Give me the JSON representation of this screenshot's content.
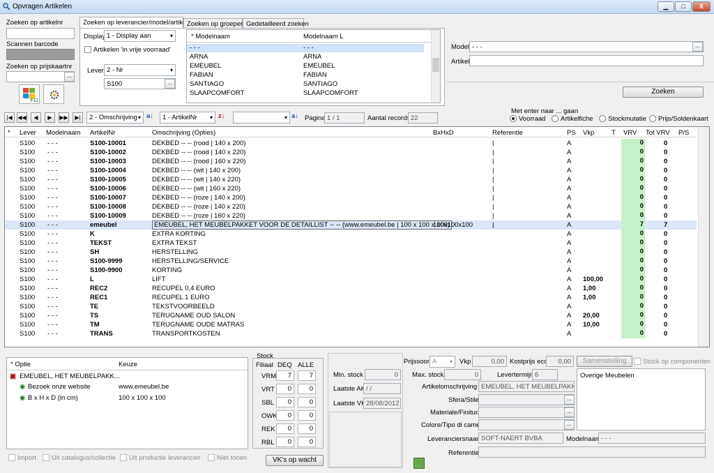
{
  "window": {
    "title": "Opvragen Artikelen",
    "min": "▁",
    "max": "□",
    "close": "X"
  },
  "left": {
    "artikelnr_label": "Zoeken op artikelnr",
    "barcode_label": "Scannen barcode",
    "prijskaart_label": "Zoeken op prijskaartnr",
    "f11": "F11"
  },
  "tabs": {
    "t1": "Zoeken op leverancier/model/artikel",
    "t2": "Zoeken op groepen",
    "t3": "Gedetailleerd zoeken"
  },
  "lev": {
    "display_label": "Display",
    "display_value": "1 - Display aan",
    "vrije_voorraad": "Artikelen 'in vrije voorraad'",
    "lever_label": "Lever",
    "lever_value": "2 - Nr",
    "lever_code": "S100"
  },
  "modellist": {
    "h1": "* Modelnaam",
    "h2": "Modelnaam L",
    "rows": [
      [
        "- - -",
        "- - -"
      ],
      [
        "ARNA",
        "ARNA"
      ],
      [
        "EMEUBEL",
        "EMEUBEL"
      ],
      [
        "FABIAN",
        "FABIAN"
      ],
      [
        "SANTIAGO",
        "SANTIAGO"
      ],
      [
        "SLAAPCOMFORT",
        "SLAAPCOMFORT"
      ]
    ]
  },
  "right": {
    "model_label": "Model",
    "model_value": "- - -",
    "artikel_label": "Artikel",
    "zoeken": "Zoeken"
  },
  "nav": {
    "sort1": "2 - Omschrijving",
    "sort2": "1 - ArtikelNr",
    "sort3": "",
    "pagina_label": "Pagina",
    "pagina": "1 / 1",
    "records_label": "Aantal records",
    "records": "22",
    "enter_label": "Met enter naar ... gaan",
    "r1": "Voorraad",
    "r2": "Artikelfiche",
    "r3": "Stockmutatie",
    "r4": "Prijs/Soldenkaart"
  },
  "grid": {
    "headers": [
      "*",
      "Lever",
      "Modelnaam",
      "ArtikelNr",
      "Omschrijving (Opties)",
      "BxHxD",
      "Referentie",
      "PS",
      "Vkp",
      "T",
      "VRV",
      "Tot VRV",
      "P/S"
    ],
    "rows": [
      [
        "S100",
        "- - -",
        "S100-10001",
        "DEKBED -- -- (rood | 140 x 200)",
        "",
        "|",
        "A",
        "",
        "0",
        "0"
      ],
      [
        "S100",
        "- - -",
        "S100-10002",
        "DEKBED -- -- (rood | 140 x 220)",
        "",
        "|",
        "A",
        "",
        "0",
        "0"
      ],
      [
        "S100",
        "- - -",
        "S100-10003",
        "DEKBED -- -- (rood | 160 x 220)",
        "",
        "|",
        "A",
        "",
        "0",
        "0"
      ],
      [
        "S100",
        "- - -",
        "S100-10004",
        "DEKBED -- -- (wit | 140 x 200)",
        "",
        "|",
        "A",
        "",
        "0",
        "0"
      ],
      [
        "S100",
        "- - -",
        "S100-10005",
        "DEKBED -- -- (wit | 140 x 220)",
        "",
        "|",
        "A",
        "",
        "0",
        "0"
      ],
      [
        "S100",
        "- - -",
        "S100-10006",
        "DEKBED -- -- (wit | 160 x 220)",
        "",
        "|",
        "A",
        "",
        "0",
        "0"
      ],
      [
        "S100",
        "- - -",
        "S100-10007",
        "DEKBED -- -- (roze | 140 x 200)",
        "",
        "|",
        "A",
        "",
        "0",
        "0"
      ],
      [
        "S100",
        "- - -",
        "S100-10008",
        "DEKBED -- -- (roze | 140 x 220)",
        "",
        "|",
        "A",
        "",
        "0",
        "0"
      ],
      [
        "S100",
        "- - -",
        "S100-10009",
        "DEKBED -- -- (roze | 160 x 220)",
        "",
        "|",
        "A",
        "",
        "0",
        "0"
      ],
      [
        "S100",
        "- - -",
        "emeubel",
        "EMEUBEL, HET MEUBELPAKKET VOOR DE DETAILLIST -- -- (www.emeubel.be | 100 x 100 x 100)",
        "100x100x100",
        "|",
        "A",
        "",
        "7",
        "7"
      ],
      [
        "S100",
        "- - -",
        "K",
        "EXTRA KORTING",
        "",
        "",
        "A",
        "",
        "0",
        "0"
      ],
      [
        "S100",
        "- - -",
        "TEKST",
        "EXTRA TEKST",
        "",
        "",
        "A",
        "",
        "0",
        "0"
      ],
      [
        "S100",
        "- - -",
        "SH",
        "HERSTELLING",
        "",
        "",
        "A",
        "",
        "0",
        "0"
      ],
      [
        "S100",
        "- - -",
        "S100-9999",
        "HERSTELLING/SERVICE",
        "",
        "",
        "A",
        "",
        "0",
        "0"
      ],
      [
        "S100",
        "- - -",
        "S100-9900",
        "KORTING",
        "",
        "",
        "A",
        "",
        "0",
        "0"
      ],
      [
        "S100",
        "- - -",
        "L",
        "LIFT",
        "",
        "",
        "A",
        "100,00",
        "0",
        "0"
      ],
      [
        "S100",
        "- - -",
        "REC2",
        "RECUPEL 0,4 EURO",
        "",
        "",
        "A",
        "1,00",
        "0",
        "0"
      ],
      [
        "S100",
        "- - -",
        "REC1",
        "RECUPEL 1 EURO",
        "",
        "",
        "A",
        "1,00",
        "0",
        "0"
      ],
      [
        "S100",
        "- - -",
        "TE",
        "TEKSTVOORBEELD",
        "",
        "",
        "A",
        "",
        "0",
        "0"
      ],
      [
        "S100",
        "- - -",
        "TS",
        "TERUGNAME OUD SALON",
        "",
        "",
        "A",
        "20,00",
        "0",
        "0"
      ],
      [
        "S100",
        "- - -",
        "TM",
        "TERUGNAME OUDE MATRAS",
        "",
        "",
        "A",
        "10,00",
        "0",
        "0"
      ],
      [
        "S100",
        "- - -",
        "TRANS",
        "TRANSPORTKOSTEN",
        "",
        "",
        "A",
        "",
        "0",
        "0"
      ]
    ]
  },
  "opties": {
    "h1": "* Optie",
    "h2": "Keuze",
    "r0": "EMEUBEL, HET MEUBELPAKK...",
    "r1a": "Bezoek onze website",
    "r1b": "www.emeubel.be",
    "r2a": "B x H x D (in cm)",
    "r2b": "100 x 100 x 100"
  },
  "bottomchecks": {
    "c1": "Import",
    "c2": "Uit catalogus/collectie",
    "c3": "Uit productie leverancier",
    "c4": "Niet tonen"
  },
  "stock": {
    "title": "Stock",
    "filiaal": "Filiaal",
    "deq": "DEQ",
    "alle": "ALLE",
    "rows": [
      [
        "VRM",
        "7",
        "7"
      ],
      [
        "VRT",
        "0",
        "0"
      ],
      [
        "SBL",
        "0",
        "0"
      ],
      [
        "OWK",
        "0",
        "0"
      ],
      [
        "REK",
        "0",
        "0"
      ],
      [
        "RBL",
        "0",
        "0"
      ]
    ],
    "vk_btn": "VK's op wacht"
  },
  "mid": {
    "min_stock_label": "Min. stock",
    "min_stock": "0",
    "max_stock_label": "Max. stock",
    "max_stock": "0",
    "laatste_ak_label": "Laatste AK",
    "laatste_ak": "/ /",
    "laatste_vk_label": "Laatste VK",
    "laatste_vk": "28/08/2012"
  },
  "detail": {
    "prijssoort_label": "Prijssoort",
    "prijssoort": "A",
    "vkp_label": "Vkp",
    "vkp": "0,00",
    "kostprijs_label": "Kostprijs eco",
    "kostprijs": "0,00",
    "samenstelling": "Samenstelling",
    "stock_comp": "Stock op componenten",
    "levertermijn_label": "Levertermijn",
    "levertermijn": "6",
    "artoms_label": "Artikelomschrijving F",
    "artoms": "EMEUBEL, HET MEUBELPAKKE",
    "sfera_label": "Sfera/Stile",
    "materiale_label": "Materiale/Finitura",
    "colore_label": "Colore/Tipo di camer",
    "levnaam_label": "Leveranciersnaam",
    "levnaam": "SOFT-NAERT BVBA",
    "modelnaam_label": "Modelnaam",
    "modelnaam": "- - -",
    "referentie_label": "Referentie",
    "groep": "Overige Meubelen"
  }
}
